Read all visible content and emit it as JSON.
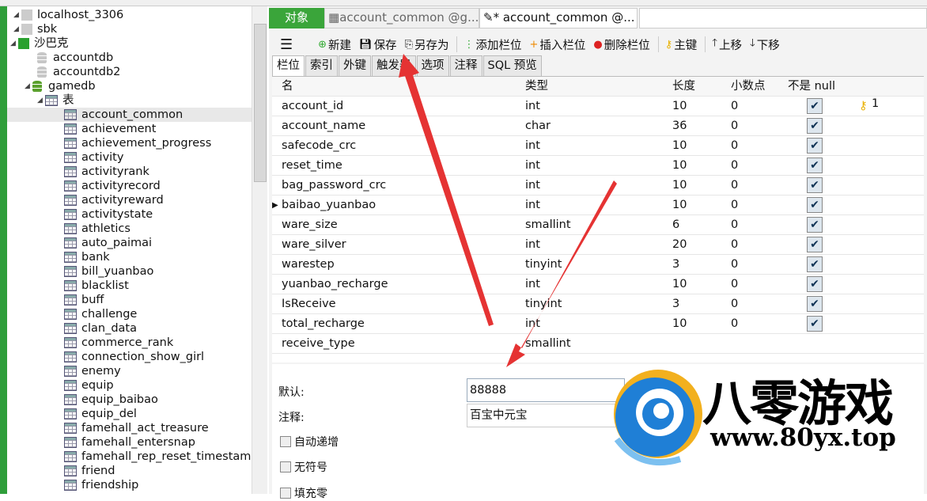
{
  "sidebar": {
    "connections": [
      {
        "label": "localhost_3306"
      },
      {
        "label": "sbk"
      },
      {
        "label": "沙巴克"
      }
    ],
    "databases": [
      {
        "label": "accountdb"
      },
      {
        "label": "accountdb2"
      },
      {
        "label": "gamedb"
      }
    ],
    "tables_folder": "表",
    "tables": [
      "account_common",
      "achievement",
      "achievement_progress",
      "activity",
      "activityrank",
      "activityrecord",
      "activityreward",
      "activitystate",
      "athletics",
      "auto_paimai",
      "bank",
      "bill_yuanbao",
      "blacklist",
      "buff",
      "challenge",
      "clan_data",
      "commerce_rank",
      "connection_show_girl",
      "enemy",
      "equip",
      "equip_baibao",
      "equip_del",
      "famehall_act_treasure",
      "famehall_entersnap",
      "famehall_rep_reset_timestam",
      "friend",
      "friendship"
    ],
    "selected": "account_common"
  },
  "tabs": {
    "objects": "对象",
    "tab1": "account_common @g...",
    "tab2": "* account_common @..."
  },
  "toolbar": {
    "new": "新建",
    "save": "保存",
    "save_as": "另存为",
    "add_field": "添加栏位",
    "insert_field": "插入栏位",
    "delete_field": "删除栏位",
    "primary_key": "主键",
    "move_up": "上移",
    "move_down": "下移"
  },
  "subtabs": [
    "栏位",
    "索引",
    "外键",
    "触发器",
    "选项",
    "注释",
    "SQL 预览"
  ],
  "grid": {
    "headers": [
      "名",
      "类型",
      "长度",
      "小数点",
      "不是 null"
    ],
    "rows": [
      {
        "name": "account_id",
        "type": "int",
        "len": "10",
        "dec": "0",
        "notnull": true,
        "key": "1"
      },
      {
        "name": "account_name",
        "type": "char",
        "len": "36",
        "dec": "0",
        "notnull": true
      },
      {
        "name": "safecode_crc",
        "type": "int",
        "len": "10",
        "dec": "0",
        "notnull": true
      },
      {
        "name": "reset_time",
        "type": "int",
        "len": "10",
        "dec": "0",
        "notnull": true
      },
      {
        "name": "bag_password_crc",
        "type": "int",
        "len": "10",
        "dec": "0",
        "notnull": true
      },
      {
        "name": "baibao_yuanbao",
        "type": "int",
        "len": "10",
        "dec": "0",
        "notnull": true,
        "current": true
      },
      {
        "name": "ware_size",
        "type": "smallint",
        "len": "6",
        "dec": "0",
        "notnull": true
      },
      {
        "name": "ware_silver",
        "type": "int",
        "len": "20",
        "dec": "0",
        "notnull": true
      },
      {
        "name": "warestep",
        "type": "tinyint",
        "len": "3",
        "dec": "0",
        "notnull": true
      },
      {
        "name": "yuanbao_recharge",
        "type": "int",
        "len": "10",
        "dec": "0",
        "notnull": true
      },
      {
        "name": "IsReceive",
        "type": "tinyint",
        "len": "3",
        "dec": "0",
        "notnull": true
      },
      {
        "name": "total_recharge",
        "type": "int",
        "len": "10",
        "dec": "0",
        "notnull": true
      },
      {
        "name": "receive_type",
        "type": "smallint",
        "len": "",
        "dec": "",
        "notnull": false
      }
    ]
  },
  "props": {
    "default_label": "默认:",
    "default_value": "88888",
    "comment_label": "注释:",
    "comment_value": "百宝中元宝",
    "auto_increment": "自动递增",
    "unsigned": "无符号",
    "zerofill": "填充零"
  },
  "watermark": {
    "brand": "八零游戏",
    "url": "www.80yx.top"
  },
  "colors": {
    "accent_green": "#3aa53a",
    "arrow": "#e53333"
  }
}
